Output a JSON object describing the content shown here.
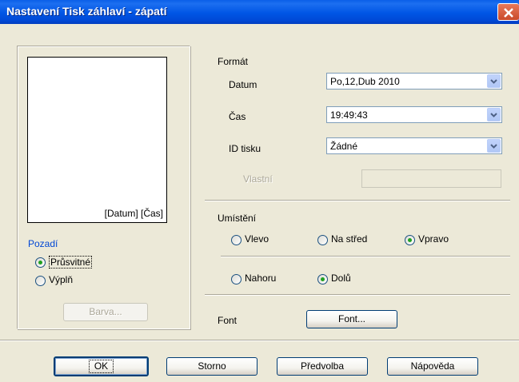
{
  "window": {
    "title": "Nastavení Tisk záhlaví - zápatí"
  },
  "preview": {
    "label": "[Datum] [Čas]"
  },
  "background": {
    "heading": "Pozadí",
    "options": [
      "Průsvitné",
      "Výplň"
    ],
    "selected": "Průsvitné",
    "color_button": "Barva..."
  },
  "format": {
    "heading": "Formát",
    "date_label": "Datum",
    "date_value": "Po,12,Dub 2010",
    "time_label": "Čas",
    "time_value": "19:49:43",
    "id_label": "ID tisku",
    "id_value": "Žádné",
    "custom_label": "Vlastní",
    "custom_value": ""
  },
  "position": {
    "heading": "Umístění",
    "horizontal": [
      "Vlevo",
      "Na střed",
      "Vpravo"
    ],
    "horizontal_selected": "Vpravo",
    "vertical": [
      "Nahoru",
      "Dolů"
    ],
    "vertical_selected": "Dolů"
  },
  "font": {
    "label": "Font",
    "button": "Font..."
  },
  "buttons": {
    "ok": "OK",
    "cancel": "Storno",
    "preset": "Předvolba",
    "help": "Nápověda"
  },
  "colors": {
    "titlebar": "#0055e5",
    "dialog_bg": "#ece9d8",
    "accent_blue": "#0046d5",
    "radio_dot": "#21a121"
  }
}
